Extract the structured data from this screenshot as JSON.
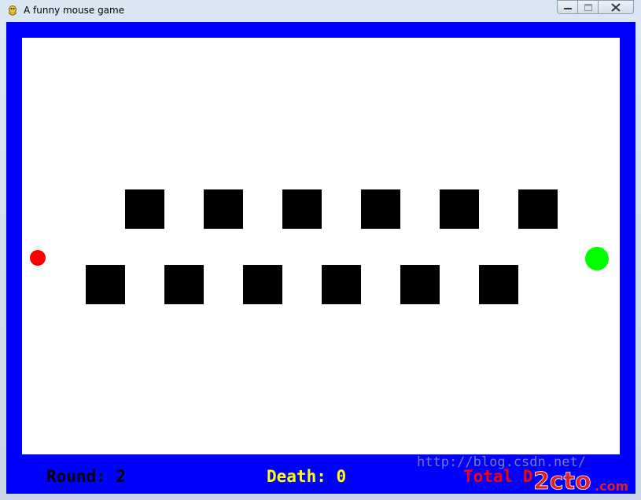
{
  "window": {
    "title": "A funny mouse game",
    "app_icon": "pygame-snake-icon",
    "controls": {
      "minimize_icon": "minimize-icon",
      "maximize_icon": "maximize-icon",
      "close_icon": "close-icon"
    }
  },
  "game": {
    "colors": {
      "border": "#0000ff",
      "arena": "#ffffff",
      "block": "#000000",
      "start": "#ff0000",
      "goal": "#00ff00"
    },
    "hud": {
      "round": "Round: 2",
      "death": "Death: 0",
      "total": "Total D",
      "round_color": "#000000",
      "death_color": "#ffff00",
      "total_color": "#ff0000"
    }
  },
  "watermark": {
    "url": "http://blog.csdn.net/",
    "logo": "2cto.com"
  }
}
